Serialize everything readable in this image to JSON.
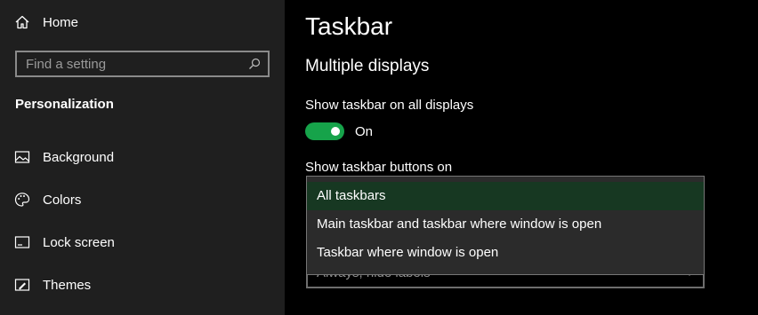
{
  "sidebar": {
    "home_label": "Home",
    "search_placeholder": "Find a setting",
    "section_title": "Personalization",
    "items": [
      {
        "label": "Background",
        "icon": "image-icon"
      },
      {
        "label": "Colors",
        "icon": "palette-icon"
      },
      {
        "label": "Lock screen",
        "icon": "lock-screen-icon"
      },
      {
        "label": "Themes",
        "icon": "themes-icon"
      }
    ]
  },
  "main": {
    "title": "Taskbar",
    "subtitle": "Multiple displays",
    "show_taskbar_label": "Show taskbar on all displays",
    "toggle_state": "On",
    "show_buttons_label": "Show taskbar buttons on",
    "dropdown_options": [
      "All taskbars",
      "Main taskbar and taskbar where window is open",
      "Taskbar where window is open"
    ],
    "selected_option": "All taskbars",
    "partial_select_value": "Always, hide labels"
  },
  "colors": {
    "toggle_on": "#16a34a",
    "selected_option_bg": "#173822",
    "sidebar_bg": "#1f1f1f",
    "main_bg": "#000000"
  }
}
